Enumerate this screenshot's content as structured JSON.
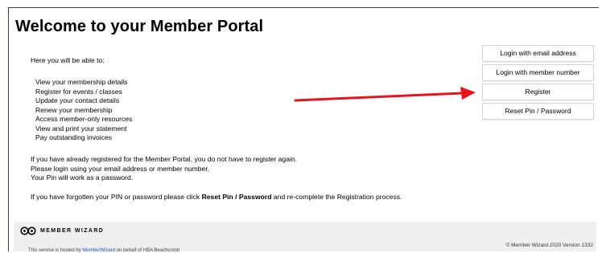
{
  "page": {
    "title": "Welcome to your Member Portal"
  },
  "content": {
    "intro": "Here you will be able to:",
    "features": [
      "View your membership details",
      "Register for events / classes",
      "Update your contact details",
      "Renew your membership",
      "Access member-only resources",
      "View and print your statement",
      "Pay outstanding invoices"
    ],
    "registered_lines": [
      "If you have already registered for the Member Portal, you do not have to register again.",
      "Please login using your email address or member number.",
      "Your Pin will work as a password."
    ],
    "forgot_prefix": "If you have forgotten your PIN or password please click ",
    "forgot_bold": "Reset Pin / Password",
    "forgot_suffix": " and re-complete the Registration process."
  },
  "buttons": {
    "login_email": "Login with email address",
    "login_member": "Login with member number",
    "register": "Register",
    "reset": "Reset Pin / Password"
  },
  "annotation": {
    "arrow_color": "#e8141b",
    "arrow_icon": "red-arrow-pointing-right"
  },
  "footer": {
    "logo_text": "MEMBER WIZARD",
    "copyright": "© Member Wizard 2020 Version 1332",
    "hosted_text": "This service is hosted by ",
    "hosted_link": "MemberWizard",
    "hosted_suffix": " on behalf of HBA Beachcomb"
  },
  "colors": {
    "border": "#2f3b6b",
    "footer_bg": "#efefef",
    "arrow": "#e8141b"
  }
}
